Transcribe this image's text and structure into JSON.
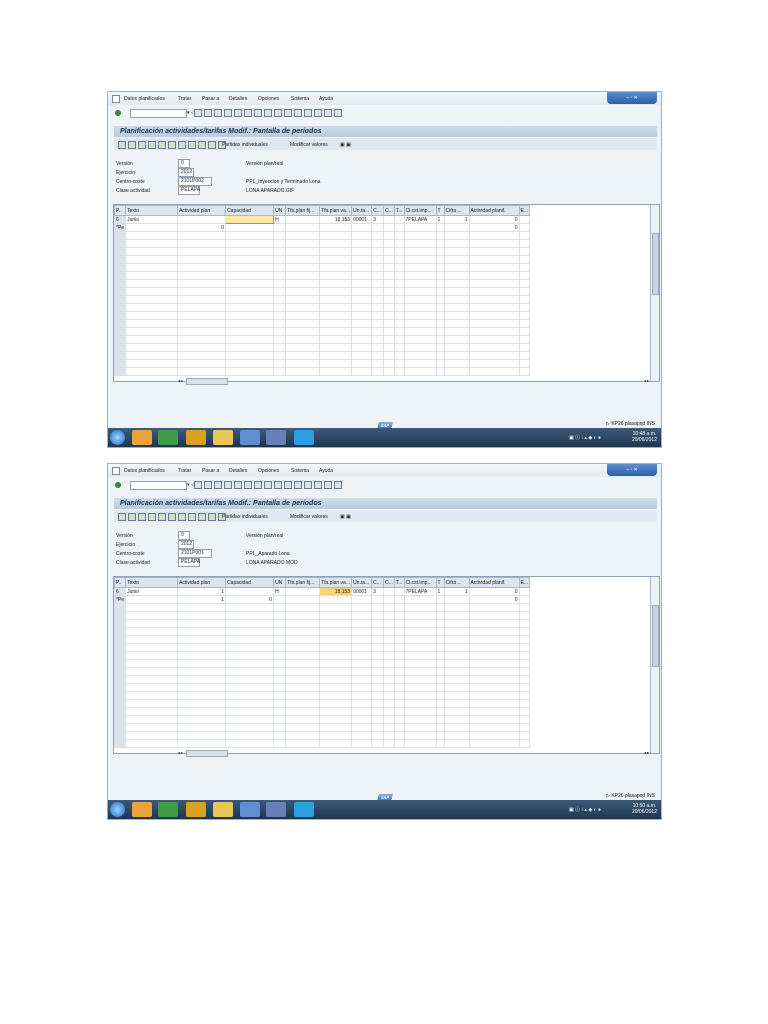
{
  "screens": [
    {
      "menu": [
        "Datos planificados",
        "Tratar",
        "Pasar a",
        "Detalles",
        "Opciones",
        "Sistema",
        "Ayuda"
      ],
      "title": "Planificación actividades/tarifas Modif.: Pantalla de períodos",
      "toolbar": {
        "btn1": "Partidas individuales",
        "btn2": "Modificar valores"
      },
      "header": {
        "version_label": "Versión",
        "version": "0",
        "version_desc": "Versión plan/real",
        "ejercicio_label": "Ejercicio",
        "ejercicio": "2012",
        "ceco_label": "Centro-coste",
        "ceco": "2101P002",
        "ceco_desc": "PPL_Inyeccion y Terminado Lona",
        "clase_label": "Clase actividad",
        "clase": "PELAPA",
        "clase_desc": "LONA APARADO GIF"
      },
      "grid": {
        "columns": [
          "P..",
          "Texto",
          "Actividad plan",
          "Capacidad",
          "UN",
          "Tfa.plan fij...",
          "Tfa.plan va...",
          "Un.ta...",
          "C...",
          "C...",
          "T...",
          "Cl.cst.imp...",
          "T",
          "Cifra ...",
          "Actividad planif.",
          "E..."
        ],
        "rows": [
          [
            "6",
            "Junio",
            "",
            "",
            "H",
            "",
            "18,153",
            "00001",
            "3",
            "",
            "",
            "7PELAPA",
            "1",
            "1",
            "0",
            ""
          ],
          [
            "*Pe",
            "",
            "0",
            "",
            "",
            "",
            "",
            "",
            "",
            "",
            "",
            "",
            "",
            "",
            "0",
            ""
          ]
        ]
      },
      "status": {
        "tcode": "KP26",
        "server": "plasapqd",
        "client": "INS"
      },
      "clock": {
        "time": "10:48 a.m.",
        "date": "20/06/2012"
      }
    },
    {
      "menu": [
        "Datos planificados",
        "Tratar",
        "Pasar a",
        "Detalles",
        "Opciones",
        "Sistema",
        "Ayuda"
      ],
      "title": "Planificación actividades/tarifas Modif.: Pantalla de períodos",
      "toolbar": {
        "btn1": "Partidas individuales",
        "btn2": "Modificar valores"
      },
      "header": {
        "version_label": "Versión",
        "version": "0",
        "version_desc": "Versión plan/real",
        "ejercicio_label": "Ejercicio",
        "ejercicio": "2012",
        "ceco_label": "Centro-coste",
        "ceco": "2101P001",
        "ceco_desc": "PPL_Aparado Lona",
        "clase_label": "Clase actividad",
        "clase": "PELAPA",
        "clase_desc": "LONA APARADO MOD"
      },
      "grid": {
        "columns": [
          "P..",
          "Texto",
          "Actividad plan",
          "Capacidad",
          "UN",
          "Tfa.plan fij...",
          "Tfa.plan va...",
          "Un.ta...",
          "C...",
          "C...",
          "T...",
          "Cl.cst.imp...",
          "T",
          "Cifra ...",
          "Actividad planif.",
          "E..."
        ],
        "rows": [
          [
            "6",
            "Junio",
            "1",
            "",
            "H",
            "",
            "18,153",
            "00001",
            "3",
            "",
            "",
            "7PELAPA",
            "1",
            "1",
            "0",
            ""
          ],
          [
            "*Pe",
            "",
            "1",
            "0",
            "",
            "",
            "",
            "",
            "",
            "",
            "",
            "",
            "",
            "",
            "0",
            ""
          ]
        ]
      },
      "status": {
        "tcode": "KP26",
        "server": "plasapqd",
        "client": "INS"
      },
      "clock": {
        "time": "10:50 a.m.",
        "date": "20/06/2012"
      }
    }
  ],
  "colors": {
    "title_bg": "#b9cadc",
    "highlight": "#ffd27a",
    "taskbar": "#1f3550"
  },
  "icons": [
    "enter-icon",
    "save-icon",
    "back-icon",
    "exit-icon",
    "cancel-icon",
    "print-icon",
    "find-icon",
    "windows-start-icon"
  ]
}
